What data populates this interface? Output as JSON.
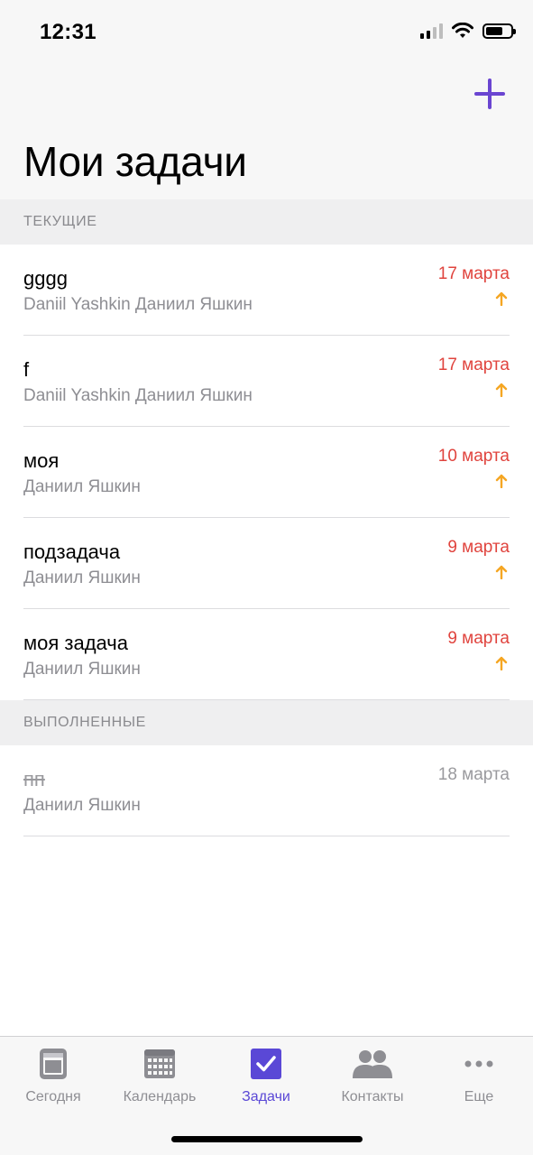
{
  "status_bar": {
    "time": "12:31"
  },
  "header": {
    "title": "Мои задачи"
  },
  "sections": {
    "current_label": "ТЕКУЩИЕ",
    "done_label": "ВЫПОЛНЕННЫЕ"
  },
  "tasks_current": [
    {
      "title": "gggg",
      "assignee": "Daniil Yashkin Даниил Яшкин",
      "date": "17 марта",
      "priority": "up-arrow-icon"
    },
    {
      "title": "f",
      "assignee": "Daniil Yashkin Даниил Яшкин",
      "date": "17 марта",
      "priority": "up-arrow-icon"
    },
    {
      "title": "моя",
      "assignee": "Даниил Яшкин",
      "date": "10 марта",
      "priority": "up-arrow-icon"
    },
    {
      "title": "подзадача",
      "assignee": "Даниил Яшкин",
      "date": "9 марта",
      "priority": "up-arrow-icon"
    },
    {
      "title": "моя задача",
      "assignee": "Даниил Яшкин",
      "date": "9 марта",
      "priority": "up-arrow-icon"
    }
  ],
  "tasks_done": [
    {
      "title": "пп",
      "assignee": "Даниил Яшкин",
      "date": "18 марта"
    }
  ],
  "tab_bar": {
    "tabs": [
      {
        "label": "Сегодня",
        "icon": "today-icon"
      },
      {
        "label": "Календарь",
        "icon": "calendar-icon"
      },
      {
        "label": "Задачи",
        "icon": "tasks-checkbox-icon",
        "active": true
      },
      {
        "label": "Контакты",
        "icon": "contacts-icon"
      },
      {
        "label": "Еще",
        "icon": "more-dots-icon"
      }
    ]
  },
  "colors": {
    "accent": "#5a48d6",
    "due_date": "#e0443e",
    "priority": "#f5a623",
    "muted": "#8e8e93"
  }
}
